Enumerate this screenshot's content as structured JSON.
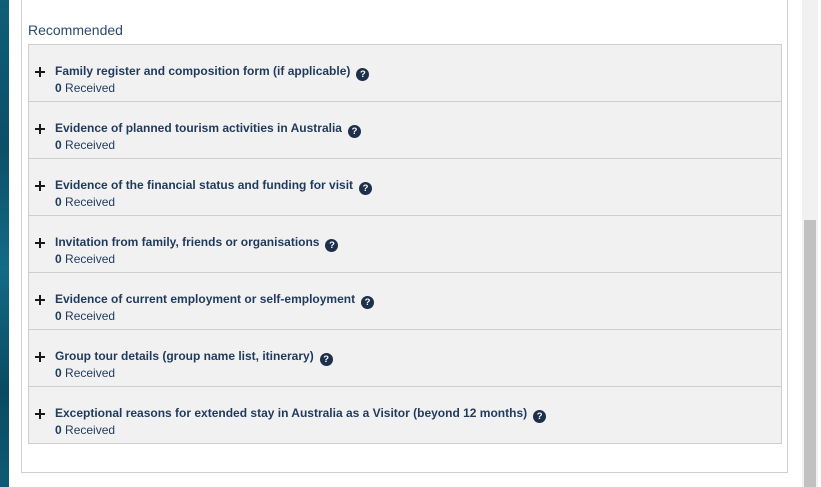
{
  "section": {
    "title": "Recommended"
  },
  "documents": [
    {
      "title": "Family register and composition form (if applicable)",
      "count": "0",
      "count_label": "Received"
    },
    {
      "title": "Evidence of planned tourism activities in Australia",
      "count": "0",
      "count_label": "Received"
    },
    {
      "title": "Evidence of the financial status and funding for visit",
      "count": "0",
      "count_label": "Received"
    },
    {
      "title": "Invitation from family, friends or organisations",
      "count": "0",
      "count_label": "Received"
    },
    {
      "title": "Evidence of current employment or self-employment",
      "count": "0",
      "count_label": "Received"
    },
    {
      "title": "Group tour details (group name list, itinerary)",
      "count": "0",
      "count_label": "Received"
    },
    {
      "title": "Exceptional reasons for extended stay in Australia as a Visitor (beyond 12 months)",
      "count": "0",
      "count_label": "Received"
    }
  ],
  "help_glyph": "?",
  "icons": {
    "expand": "plus-icon",
    "help": "help-icon"
  },
  "colors": {
    "text": "#1f3a5c",
    "row_bg": "#f1f1f1",
    "help_bg": "#1d2f4a"
  }
}
